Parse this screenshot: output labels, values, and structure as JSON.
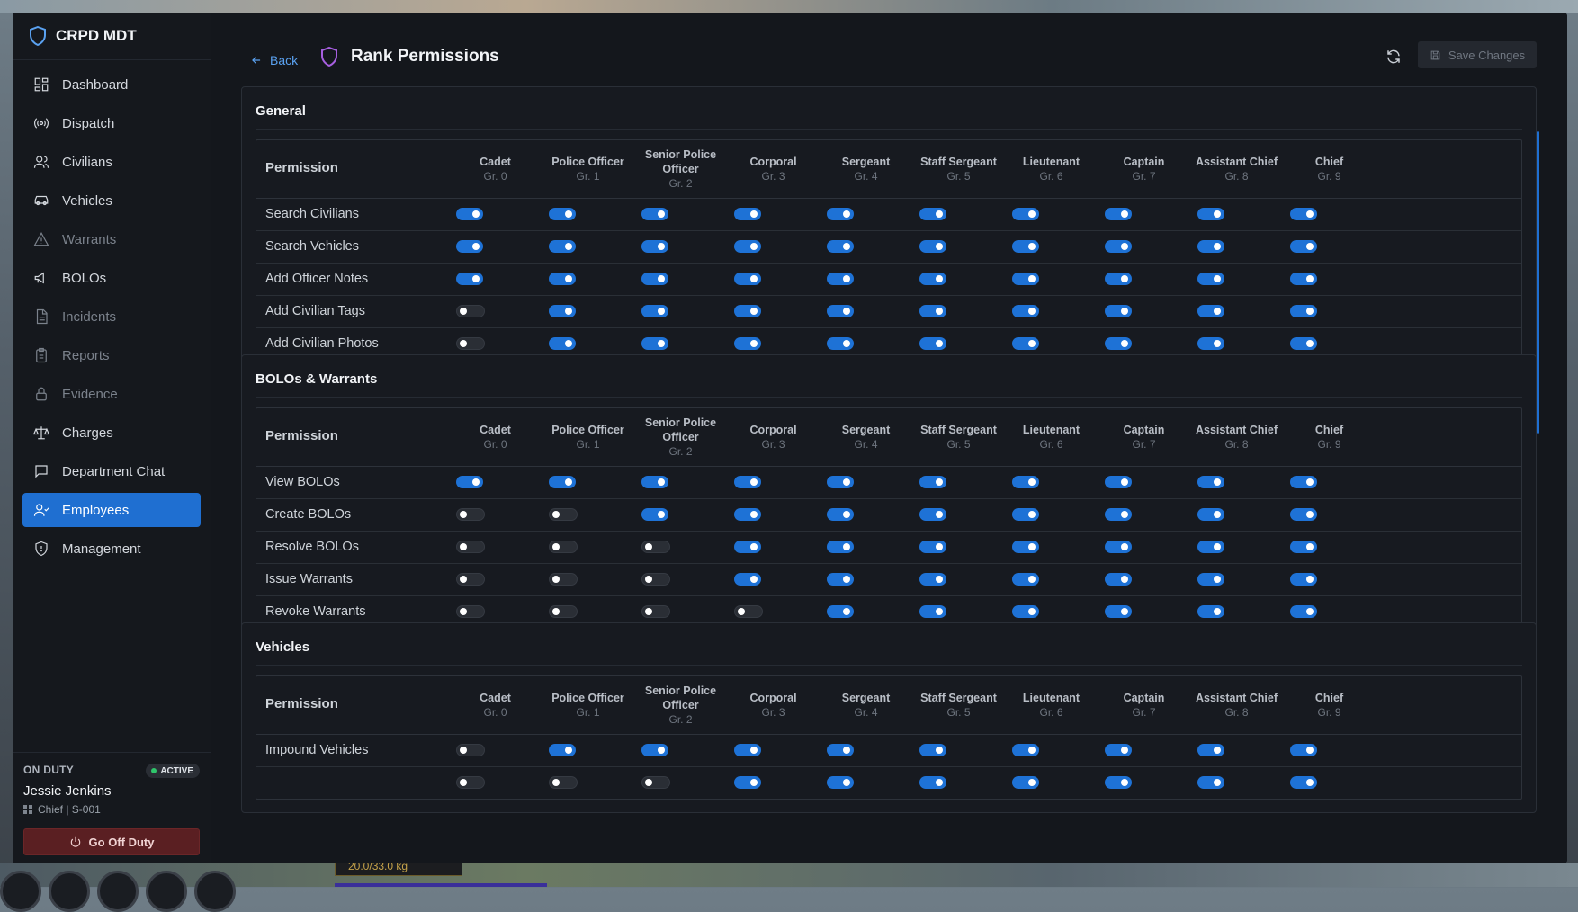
{
  "app": {
    "title": "CRPD MDT"
  },
  "sidebar": {
    "items": [
      {
        "label": "Dashboard",
        "icon": "dashboard-icon",
        "dim": false,
        "active": false
      },
      {
        "label": "Dispatch",
        "icon": "broadcast-icon",
        "dim": false,
        "active": false
      },
      {
        "label": "Civilians",
        "icon": "users-icon",
        "dim": false,
        "active": false
      },
      {
        "label": "Vehicles",
        "icon": "car-icon",
        "dim": false,
        "active": false
      },
      {
        "label": "Warrants",
        "icon": "warning-icon",
        "dim": true,
        "active": false
      },
      {
        "label": "BOLOs",
        "icon": "megaphone-icon",
        "dim": false,
        "active": false
      },
      {
        "label": "Incidents",
        "icon": "file-icon",
        "dim": true,
        "active": false
      },
      {
        "label": "Reports",
        "icon": "clipboard-icon",
        "dim": true,
        "active": false
      },
      {
        "label": "Evidence",
        "icon": "lock-icon",
        "dim": true,
        "active": false
      },
      {
        "label": "Charges",
        "icon": "scale-icon",
        "dim": false,
        "active": false
      },
      {
        "label": "Department Chat",
        "icon": "chat-icon",
        "dim": false,
        "active": false
      },
      {
        "label": "Employees",
        "icon": "employees-icon",
        "dim": false,
        "active": true
      },
      {
        "label": "Management",
        "icon": "shield-icon",
        "dim": false,
        "active": false
      }
    ]
  },
  "duty": {
    "label": "ON DUTY",
    "badge": "ACTIVE",
    "name": "Jessie Jenkins",
    "rank": "Chief | S-001",
    "button": "Go Off Duty"
  },
  "header": {
    "back": "Back",
    "title": "Rank Permissions",
    "save": "Save Changes"
  },
  "hud": {
    "weight": "20.0/33.0 kg"
  },
  "permission_header": "Permission",
  "ranks": [
    {
      "name": "Cadet",
      "grade": "Gr. 0"
    },
    {
      "name": "Police Officer",
      "grade": "Gr. 1"
    },
    {
      "name": "Senior Police Officer",
      "grade": "Gr. 2"
    },
    {
      "name": "Corporal",
      "grade": "Gr. 3"
    },
    {
      "name": "Sergeant",
      "grade": "Gr. 4"
    },
    {
      "name": "Staff Sergeant",
      "grade": "Gr. 5"
    },
    {
      "name": "Lieutenant",
      "grade": "Gr. 6"
    },
    {
      "name": "Captain",
      "grade": "Gr. 7"
    },
    {
      "name": "Assistant Chief",
      "grade": "Gr. 8"
    },
    {
      "name": "Chief",
      "grade": "Gr. 9"
    }
  ],
  "sections": [
    {
      "title": "General",
      "rows": [
        {
          "label": "Search Civilians",
          "values": [
            true,
            true,
            true,
            true,
            true,
            true,
            true,
            true,
            true,
            true
          ]
        },
        {
          "label": "Search Vehicles",
          "values": [
            true,
            true,
            true,
            true,
            true,
            true,
            true,
            true,
            true,
            true
          ]
        },
        {
          "label": "Add Officer Notes",
          "values": [
            true,
            true,
            true,
            true,
            true,
            true,
            true,
            true,
            true,
            true
          ]
        },
        {
          "label": "Add Civilian Tags",
          "values": [
            false,
            true,
            true,
            true,
            true,
            true,
            true,
            true,
            true,
            true
          ]
        },
        {
          "label": "Add Civilian Photos",
          "values": [
            false,
            true,
            true,
            true,
            true,
            true,
            true,
            true,
            true,
            true
          ]
        }
      ]
    },
    {
      "title": "BOLOs & Warrants",
      "rows": [
        {
          "label": "View BOLOs",
          "values": [
            true,
            true,
            true,
            true,
            true,
            true,
            true,
            true,
            true,
            true
          ]
        },
        {
          "label": "Create BOLOs",
          "values": [
            false,
            false,
            true,
            true,
            true,
            true,
            true,
            true,
            true,
            true
          ]
        },
        {
          "label": "Resolve BOLOs",
          "values": [
            false,
            false,
            false,
            true,
            true,
            true,
            true,
            true,
            true,
            true
          ]
        },
        {
          "label": "Issue Warrants",
          "values": [
            false,
            false,
            false,
            true,
            true,
            true,
            true,
            true,
            true,
            true
          ]
        },
        {
          "label": "Revoke Warrants",
          "values": [
            false,
            false,
            false,
            false,
            true,
            true,
            true,
            true,
            true,
            true
          ]
        }
      ]
    },
    {
      "title": "Vehicles",
      "rows": [
        {
          "label": "Impound Vehicles",
          "values": [
            false,
            true,
            true,
            true,
            true,
            true,
            true,
            true,
            true,
            true
          ]
        },
        {
          "label": "",
          "values": [
            false,
            false,
            false,
            true,
            true,
            true,
            true,
            true,
            true,
            true
          ]
        }
      ]
    }
  ]
}
